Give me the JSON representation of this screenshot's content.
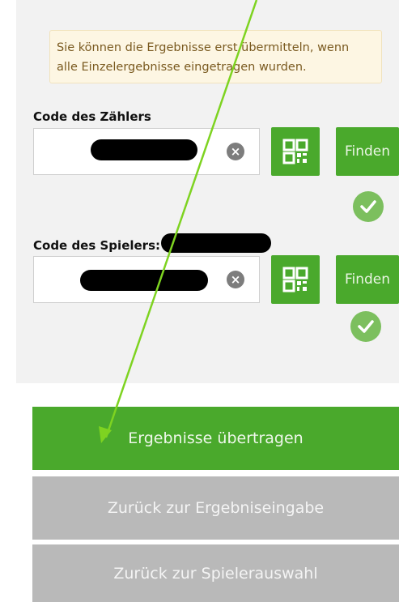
{
  "notice": {
    "line1": "Sie können die Ergebnisse erst übermitteln, wenn",
    "line2": "alle Einzelergebnisse eingetragen wurden."
  },
  "counter_code": {
    "label": "Code des Zählers",
    "find_label": "Finden"
  },
  "player_code": {
    "label": "Code des Spielers:",
    "find_label": "Finden"
  },
  "buttons": {
    "submit": "Ergebnisse übertragen",
    "back_results": "Zurück zur Ergebniseingabe",
    "back_players": "Zurück zur Spielerauswahl"
  },
  "icons": {
    "clear": "close-circle-icon",
    "qr": "qr-code-icon",
    "check": "check-circle-icon"
  },
  "colors": {
    "primary": "#4aa92c",
    "secondary": "#b9b9b9",
    "notice_bg": "#fdf6e3",
    "annotation_arrow": "#7ed321"
  }
}
